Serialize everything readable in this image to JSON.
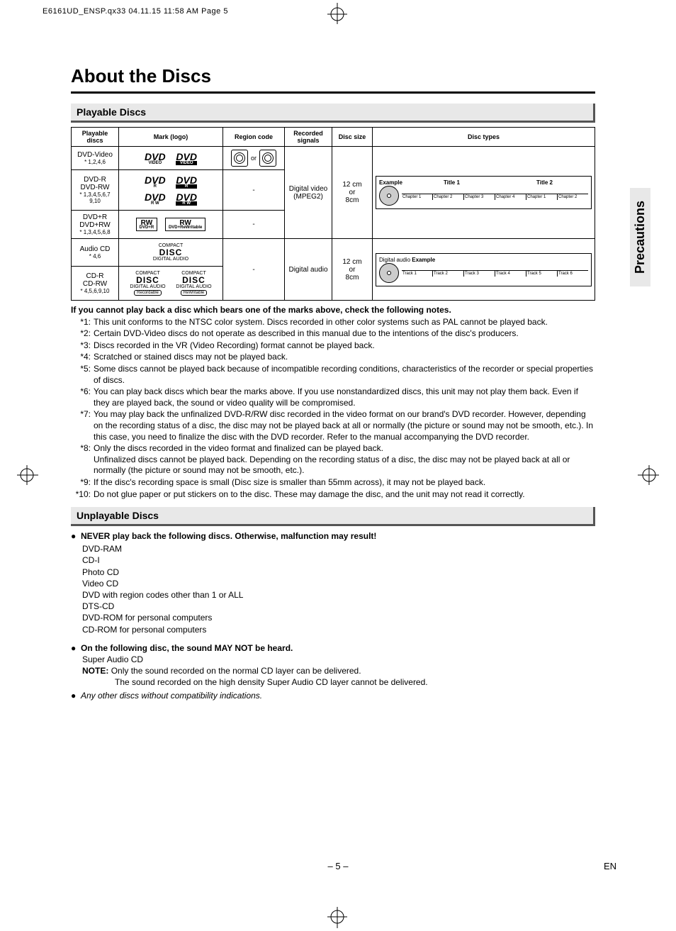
{
  "print_header": "E6161UD_ENSP.qx33  04.11.15 11:58 AM  Page 5",
  "title": "About the Discs",
  "side_tab": "Precautions",
  "section_playable": "Playable Discs",
  "section_unplayable": "Unplayable Discs",
  "page_num": "– 5 –",
  "lang": "EN",
  "th": {
    "c1": "Playable discs",
    "c2": "Mark (logo)",
    "c3": "Region code",
    "c4": "Recorded signals",
    "c5": "Disc size",
    "c6": "Disc types"
  },
  "row1": {
    "name": "DVD-Video",
    "note": "* 1,2,4,6",
    "rc_or": "or"
  },
  "row2": {
    "name": "DVD-R\nDVD-RW",
    "note": "* 1,3,4,5,6,7\n9,10",
    "rc": "-"
  },
  "row3": {
    "name": "DVD+R\nDVD+RW",
    "note": "* 1,3,4,5,6,8",
    "rc": "-"
  },
  "row4": {
    "name": "Audio CD",
    "note": "* 4,6"
  },
  "row5": {
    "name": "CD-R\nCD-RW",
    "note": "* 4,5,6,9,10",
    "rc": "-"
  },
  "sig_dvd": "Digital video\n(MPEG2)",
  "sig_cd": "Digital audio",
  "size": "12 cm\nor\n8cm",
  "ex": {
    "label": "Example",
    "t1": "Title 1",
    "t2": "Title 2",
    "ch1": "Chapter 1",
    "ch2": "Chapter 2",
    "ch3": "Chapter 3",
    "ch4": "Chapter 4",
    "da": "Digital audio",
    "tr1": "Track 1",
    "tr2": "Track 2",
    "tr3": "Track 3",
    "tr4": "Track 4",
    "tr5": "Track 5",
    "tr6": "Track 6"
  },
  "logos": {
    "dvd": "DVD",
    "video": "VIDEO",
    "r": "R",
    "rw": "R W",
    "plusr": "DVD+R",
    "plusrw": "DVD+ReWritable",
    "rwmark": "RW",
    "cd_compact": "COMPACT",
    "cd_disc": "DISC",
    "cd_da": "DIGITAL AUDIO",
    "cd_rec": "Recordable",
    "cd_rew": "ReWritable"
  },
  "notes_lead": "If you cannot play back a disc which bears one of the marks above, check the following notes.",
  "n1": "This unit conforms to the NTSC color system. Discs recorded in other color systems such as PAL cannot be played back.",
  "n2": "Certain DVD-Video discs do not operate as described in this manual due to the intentions of the disc's producers.",
  "n3": "Discs recorded in the VR (Video Recording) format cannot be played back.",
  "n4": "Scratched or stained discs may not be played back.",
  "n5": "Some discs cannot be played back because of incompatible recording conditions, characteristics of the recorder or special properties of discs.",
  "n6": "You can play back discs which bear the marks above. If you use nonstandardized discs, this unit may not play them back. Even if they are played back, the sound or video quality will be compromised.",
  "n7": "You may play back the unfinalized DVD-R/RW disc recorded in the video format on our brand's DVD recorder. However, depending on the recording status of a disc, the disc may not be played back at all or normally (the picture or sound may not be smooth, etc.). In this case, you need to finalize the disc with the DVD recorder. Refer to the manual accompanying the DVD recorder.",
  "n8": "Only the discs recorded in the video format and finalized can be played back.\nUnfinalized discs cannot be played back. Depending on the recording status of a disc, the disc may not be played back at all or normally (the picture or sound may not be smooth, etc.).",
  "n9": "If the disc's recording space is small (Disc size is smaller than 55mm across), it may not be played back.",
  "n10": "Do not glue paper or put stickers on to the disc. These may damage the disc, and the unit may not read it correctly.",
  "up": {
    "head1": "NEVER play back the following discs. Otherwise, malfunction may result!",
    "l1": "DVD-RAM",
    "l2": "CD-I",
    "l3": "Photo CD",
    "l4": "Video CD",
    "l5": "DVD with region codes other than 1 or ALL",
    "l6": "DTS-CD",
    "l7": "DVD-ROM for personal computers",
    "l8": "CD-ROM for personal computers",
    "head2": "On the following disc, the sound MAY NOT be heard.",
    "sa": "Super Audio CD",
    "note_l": "NOTE:",
    "note1": "Only the sound recorded on the normal CD layer can be delivered.",
    "note2": "The sound recorded on the high density Super Audio CD layer cannot be delivered.",
    "other": "Any other discs without compatibility indications."
  }
}
